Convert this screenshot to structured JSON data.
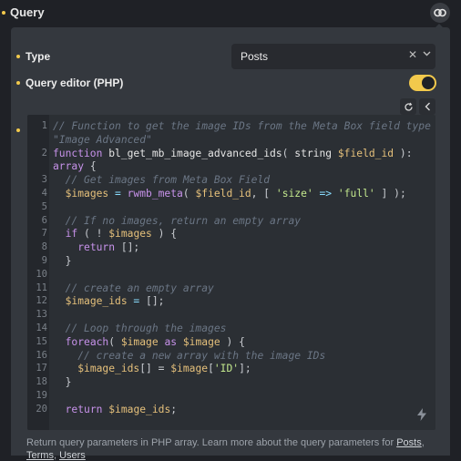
{
  "header": {
    "title": "Query"
  },
  "fields": {
    "type_label": "Type",
    "type_value": "Posts",
    "query_editor_label": "Query editor (PHP)",
    "query_editor_enabled": true
  },
  "editor": {
    "lines": [
      {
        "n": "1",
        "parts": [
          {
            "t": "// Function to get the image IDs from the Meta Box field type",
            "c": "c-com"
          }
        ]
      },
      {
        "n": "",
        "parts": [
          {
            "t": "\"Image Advanced\"",
            "c": "c-com"
          }
        ]
      },
      {
        "n": "2",
        "parts": [
          {
            "t": "function ",
            "c": "c-kw"
          },
          {
            "t": "bl_get_mb_image_advanced_ids",
            "c": "c-fn"
          },
          {
            "t": "( ",
            "c": ""
          },
          {
            "t": "string ",
            "c": "c-type"
          },
          {
            "t": "$field_id",
            "c": "c-var"
          },
          {
            "t": " ):",
            "c": ""
          }
        ]
      },
      {
        "n": "",
        "parts": [
          {
            "t": "array",
            "c": "c-kw"
          },
          {
            "t": " {",
            "c": ""
          }
        ]
      },
      {
        "n": "3",
        "parts": [
          {
            "t": "  // Get images from Meta Box Field",
            "c": "c-com"
          }
        ]
      },
      {
        "n": "4",
        "parts": [
          {
            "t": "  ",
            "c": ""
          },
          {
            "t": "$images",
            "c": "c-var"
          },
          {
            "t": " = ",
            "c": "c-op"
          },
          {
            "t": "rwmb_meta",
            "c": "c-kw"
          },
          {
            "t": "( ",
            "c": ""
          },
          {
            "t": "$field_id",
            "c": "c-var"
          },
          {
            "t": ", [ ",
            "c": ""
          },
          {
            "t": "'size'",
            "c": "c-str"
          },
          {
            "t": " => ",
            "c": "c-op"
          },
          {
            "t": "'full'",
            "c": "c-str"
          },
          {
            "t": " ] );",
            "c": ""
          }
        ]
      },
      {
        "n": "5",
        "parts": []
      },
      {
        "n": "6",
        "parts": [
          {
            "t": "  // If no images, return an empty array",
            "c": "c-com"
          }
        ]
      },
      {
        "n": "7",
        "parts": [
          {
            "t": "  ",
            "c": ""
          },
          {
            "t": "if",
            "c": "c-kw"
          },
          {
            "t": " ( ! ",
            "c": ""
          },
          {
            "t": "$images",
            "c": "c-var"
          },
          {
            "t": " ) {",
            "c": ""
          }
        ]
      },
      {
        "n": "8",
        "parts": [
          {
            "t": "    ",
            "c": ""
          },
          {
            "t": "return",
            "c": "c-kw"
          },
          {
            "t": " [];",
            "c": ""
          }
        ]
      },
      {
        "n": "9",
        "parts": [
          {
            "t": "  }",
            "c": ""
          }
        ]
      },
      {
        "n": "10",
        "parts": []
      },
      {
        "n": "11",
        "parts": [
          {
            "t": "  // create an empty array",
            "c": "c-com"
          }
        ]
      },
      {
        "n": "12",
        "parts": [
          {
            "t": "  ",
            "c": ""
          },
          {
            "t": "$image_ids",
            "c": "c-var"
          },
          {
            "t": " = ",
            "c": "c-op"
          },
          {
            "t": "[];",
            "c": ""
          }
        ]
      },
      {
        "n": "13",
        "parts": []
      },
      {
        "n": "14",
        "parts": [
          {
            "t": "  // Loop through the images",
            "c": "c-com"
          }
        ]
      },
      {
        "n": "15",
        "parts": [
          {
            "t": "  ",
            "c": ""
          },
          {
            "t": "foreach",
            "c": "c-kw"
          },
          {
            "t": "( ",
            "c": ""
          },
          {
            "t": "$image",
            "c": "c-var"
          },
          {
            "t": " as ",
            "c": "c-kw"
          },
          {
            "t": "$image",
            "c": "c-var"
          },
          {
            "t": " ) {",
            "c": ""
          }
        ]
      },
      {
        "n": "16",
        "parts": [
          {
            "t": "    // create a new array with the image IDs",
            "c": "c-com"
          }
        ]
      },
      {
        "n": "17",
        "parts": [
          {
            "t": "    ",
            "c": ""
          },
          {
            "t": "$image_ids",
            "c": "c-var"
          },
          {
            "t": "[] = ",
            "c": ""
          },
          {
            "t": "$image",
            "c": "c-var"
          },
          {
            "t": "[",
            "c": ""
          },
          {
            "t": "'ID'",
            "c": "c-str"
          },
          {
            "t": "];",
            "c": ""
          }
        ]
      },
      {
        "n": "18",
        "parts": [
          {
            "t": "  }",
            "c": ""
          }
        ]
      },
      {
        "n": "19",
        "parts": []
      },
      {
        "n": "20",
        "parts": [
          {
            "t": "  ",
            "c": ""
          },
          {
            "t": "return",
            "c": "c-kw"
          },
          {
            "t": " ",
            "c": ""
          },
          {
            "t": "$image_ids",
            "c": "c-var"
          },
          {
            "t": ";",
            "c": ""
          }
        ]
      }
    ]
  },
  "footer": {
    "text": "Return query parameters in PHP array. Learn more about the query parameters for ",
    "link_posts": "Posts",
    "sep": ",",
    "link_terms": "Terms",
    "link_users": "Users"
  },
  "colors": {
    "accent": "#f2c94c",
    "panel": "#34383e",
    "background": "#1f2126"
  },
  "icons": [
    "link-icon",
    "close-icon",
    "chevron-down-icon",
    "refresh-icon",
    "chevron-left-icon",
    "bolt-icon"
  ]
}
